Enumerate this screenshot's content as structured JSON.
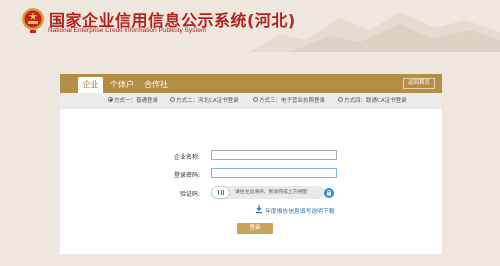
{
  "header": {
    "title": "国家企业信用信息公示系统(河北)",
    "subtitle": "National Enterprise Credit Information Publicity System"
  },
  "tabs": [
    {
      "label": "企业",
      "active": true
    },
    {
      "label": "个体户",
      "active": false
    },
    {
      "label": "合作社",
      "active": false
    }
  ],
  "back_label": "返回首页",
  "login_methods": [
    {
      "label": "方式一：普通登录",
      "selected": true
    },
    {
      "label": "方式二：河北CA证书登录",
      "selected": false
    },
    {
      "label": "方式三：电子营业执照登录",
      "selected": false
    },
    {
      "label": "方式四：联通CA证书登录",
      "selected": false
    }
  ],
  "form": {
    "company_label": "企业名称:",
    "company_value": "",
    "password_label": "登录密码:",
    "password_value": "",
    "captcha_label": "验证码:",
    "slider_hint": "请住左边滑块，拖动完成上方拼图"
  },
  "download_label": "年度报告信息填写说明下载",
  "login_label": "登录",
  "colors": {
    "accent": "#b48e46",
    "title": "#b3221c",
    "button": "#c9a45a",
    "link": "#2f6fb0"
  }
}
